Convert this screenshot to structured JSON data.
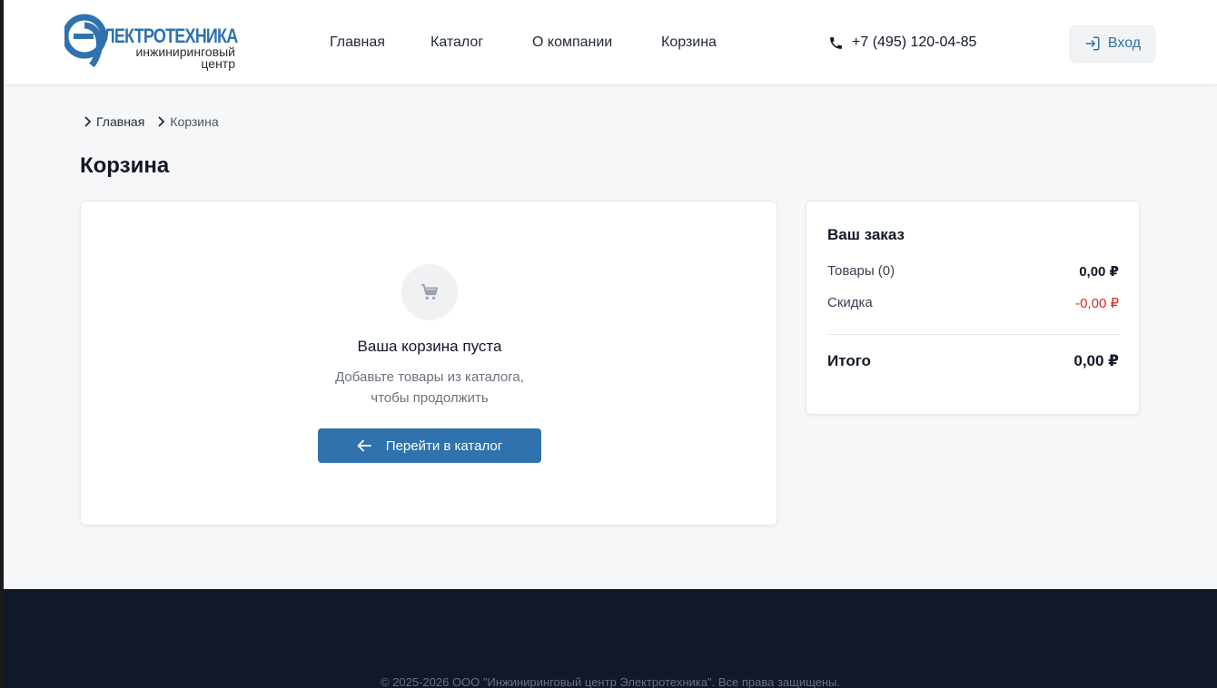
{
  "header": {
    "logo": {
      "main": "ЛЕКТРОТЕХНИКА",
      "sub1": "инжиниринговый",
      "sub2": "центр",
      "brand_color": "#2f72ad"
    },
    "nav": [
      {
        "label": "Главная"
      },
      {
        "label": "Каталог"
      },
      {
        "label": "О компании"
      },
      {
        "label": "Корзина"
      }
    ],
    "phone": "+7 (495) 120-04-85",
    "login_label": "Вход"
  },
  "breadcrumb": [
    {
      "label": "Главная"
    },
    {
      "label": "Корзина"
    }
  ],
  "page_title": "Корзина",
  "cart": {
    "icon": "cart-icon",
    "empty_title": "Ваша корзина пуста",
    "empty_desc_line1": "Добавьте товары из каталога,",
    "empty_desc_line2": "чтобы продолжить",
    "catalog_button": "Перейти в каталог"
  },
  "order": {
    "title": "Ваш заказ",
    "items_label": "Товары (0)",
    "items_value": "0,00 ₽",
    "discount_label": "Скидка",
    "discount_value": "-0,00 ₽",
    "total_label": "Итого",
    "total_value": "0,00 ₽"
  },
  "footer": {
    "copyright": "© 2025-2026 ООО \"Инжиниринговый центр Электротехника\". Все права защищены."
  },
  "colors": {
    "accent": "#2f72ad",
    "discount": "#dc2626",
    "footer_bg": "#111827"
  }
}
